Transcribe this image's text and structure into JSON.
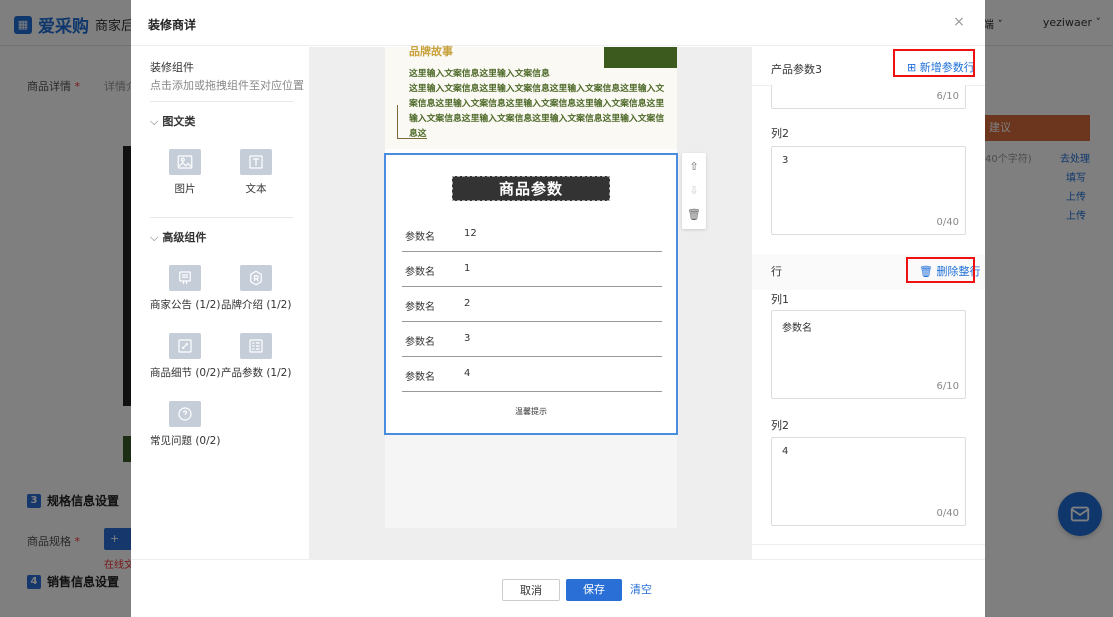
{
  "background": {
    "logo_text": "爱采购",
    "logo_sub": "商家后",
    "top_right": [
      "客户端",
      "yeziwaer"
    ],
    "left_labels": [
      "商品详情",
      "详情介"
    ],
    "sections": [
      {
        "num": "3",
        "title": "规格信息设置"
      },
      {
        "num": "4",
        "title": "销售信息设置"
      }
    ],
    "spec_label": "商品规格",
    "spec_btn": "+",
    "spec_tip": "在线文",
    "right_col": {
      "header": "建议",
      "hint": "40个字符)",
      "links": [
        "去处理",
        "填写",
        "上传",
        "上传"
      ]
    }
  },
  "modal": {
    "title": "装修商详",
    "close": "×",
    "left": {
      "title": "装修组件",
      "hint": "点击添加或拖拽组件至对应位置",
      "groups": [
        {
          "label": "图文类",
          "items": [
            {
              "label": "图片",
              "icon": "image-icon"
            },
            {
              "label": "文本",
              "icon": "text-icon"
            }
          ]
        },
        {
          "label": "高级组件",
          "items": [
            {
              "label": "商家公告 (1/2)",
              "icon": "notice-icon"
            },
            {
              "label": "品牌介绍 (1/2)",
              "icon": "brand-icon"
            },
            {
              "label": "商品细节 (0/2)",
              "icon": "detail-icon"
            },
            {
              "label": "产品参数 (1/2)",
              "icon": "params-icon"
            },
            {
              "label": "常见问题 (0/2)",
              "icon": "faq-icon"
            }
          ]
        }
      ]
    },
    "preview": {
      "top_gold": "品牌故事",
      "line1": "这里输入文案信息这里输入文案信息",
      "para": "这里输入文案信息这里输入文案信息这里输入文案信息这里输入文案信息这里输入文案信息这里输入文案信息这里输入文案信息这里输入文案信息这里输入文案信息这里输入文案信息这里输入文案信息这",
      "param_title": "商品参数",
      "rows": [
        {
          "k": "参数名",
          "v": "12"
        },
        {
          "k": "参数名",
          "v": "1"
        },
        {
          "k": "参数名",
          "v": "2"
        },
        {
          "k": "参数名",
          "v": "3"
        },
        {
          "k": "参数名",
          "v": "4"
        }
      ],
      "footer": "温馨提示",
      "tools": [
        "up-arrow-icon",
        "down-arrow-icon",
        "trash-icon"
      ]
    },
    "right": {
      "section_title": "产品参数3",
      "add_row": "新增参数行",
      "counter_top": "6/10",
      "col2_label": "列2",
      "col2_value": "3",
      "col2_count": "0/40",
      "row_label": "行",
      "delete_row": "删除整行",
      "col1_label": "列1",
      "col1_value": "参数名",
      "col1_count": "6/10",
      "col2b_label": "列2",
      "col2b_value": "4",
      "col2b_count": "0/40"
    },
    "footer": {
      "cancel": "取消",
      "save": "保存",
      "clear": "清空"
    }
  }
}
